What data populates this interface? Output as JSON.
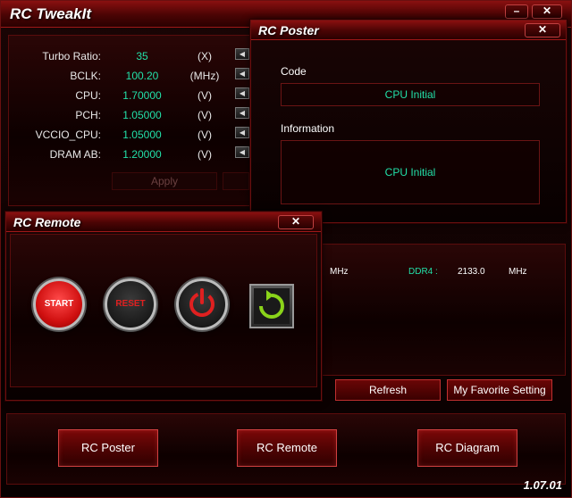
{
  "tweakit": {
    "title": "RC TweakIt",
    "minimize": "–",
    "close": "✕",
    "rows": [
      {
        "label": "Turbo Ratio:",
        "value": "35",
        "unit": "(X)"
      },
      {
        "label": "BCLK:",
        "value": "100.20",
        "unit": "(MHz)"
      },
      {
        "label": "CPU:",
        "value": "1.70000",
        "unit": "(V)"
      },
      {
        "label": "PCH:",
        "value": "1.05000",
        "unit": "(V)"
      },
      {
        "label": "VCCIO_CPU:",
        "value": "1.05000",
        "unit": "(V)"
      },
      {
        "label": "DRAM AB:",
        "value": "1.20000",
        "unit": "(V)"
      }
    ],
    "apply_label": "Apply",
    "info": {
      "unit1": "MHz",
      "ddr_label": "DDR4 :",
      "ddr_value": "2133.0",
      "unit2": "MHz"
    },
    "refresh_label": "Refresh",
    "favorite_label": "My Favorite Setting",
    "bottom_buttons": {
      "poster": "RC Poster",
      "remote": "RC Remote",
      "diagram": "RC Diagram"
    },
    "version": "1.07.01"
  },
  "poster": {
    "title": "RC Poster",
    "close": "✕",
    "code_label": "Code",
    "code_value": "CPU Initial",
    "info_label": "Information",
    "info_value": "CPU Initial"
  },
  "remote": {
    "title": "RC Remote",
    "close": "✕",
    "start_label": "START",
    "reset_label": "RESET"
  },
  "colors": {
    "accent_red": "#c03030",
    "value_green": "#22e0a8"
  }
}
